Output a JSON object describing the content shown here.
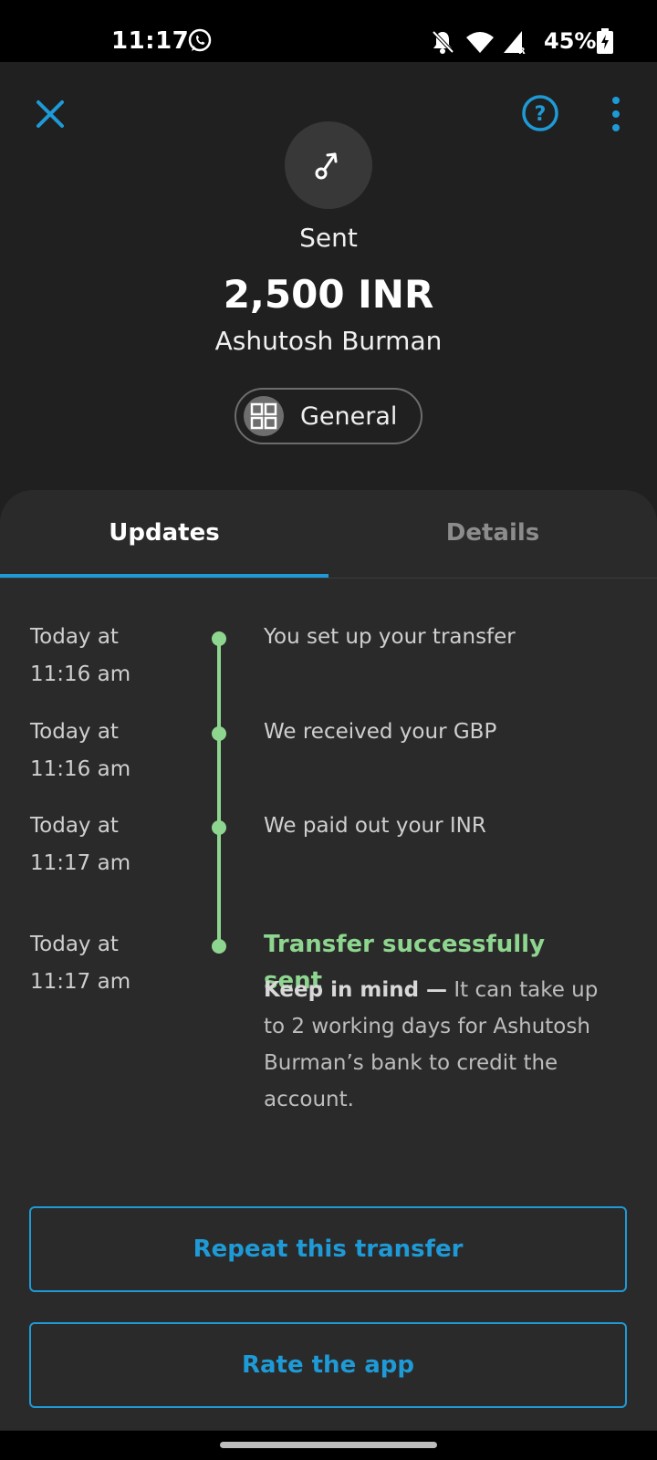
{
  "status_bar": {
    "time": "11:17",
    "battery": "45%",
    "icons": [
      "whatsapp-icon",
      "bell-off-icon",
      "wifi-icon",
      "signal-icon",
      "battery-charging-icon"
    ]
  },
  "header": {
    "status": "Sent",
    "amount": "2,500 INR",
    "recipient": "Ashutosh Burman",
    "category": "General",
    "icons": [
      "close-icon",
      "help-icon",
      "more-vert-icon",
      "sent-arrow-icon",
      "grid-icon"
    ]
  },
  "tabs": [
    {
      "label": "Updates",
      "active": true
    },
    {
      "label": "Details",
      "active": false
    }
  ],
  "timeline": [
    {
      "time": "Today at 11:16 am",
      "text": "You set up your transfer"
    },
    {
      "time": "Today at 11:16 am",
      "text": "We received your GBP"
    },
    {
      "time": "Today at 11:17 am",
      "text": "We paid out your INR"
    },
    {
      "time": "Today at 11:17 am",
      "text": "Transfer successfully sent"
    }
  ],
  "note": {
    "bold": "Keep in mind —",
    "text": " It can take up to 2 working days for Ashutosh Burman’s bank to credit the account."
  },
  "buttons": {
    "repeat": "Repeat this transfer",
    "rate": "Rate the app"
  },
  "colors": {
    "accent": "#1e9ad6",
    "success": "#8ed68f",
    "background": "#202020",
    "card": "#2a2a2a"
  }
}
